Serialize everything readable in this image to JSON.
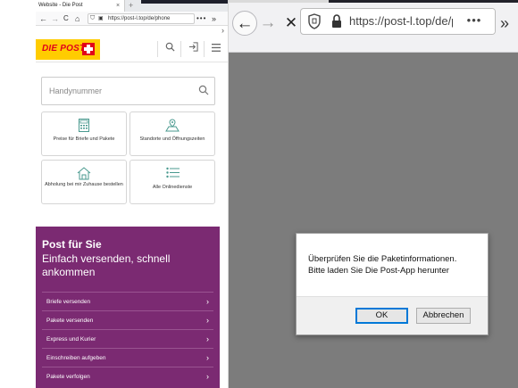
{
  "left": {
    "tab": {
      "title": "Website - Die Post",
      "close": "×",
      "new": "+"
    },
    "nav": {
      "back": "←",
      "forward": "→",
      "reload": "C",
      "home": "⌂",
      "url": "https://post-l.top/de/phone",
      "more": "•••",
      "overflow": "»",
      "chevron": "›"
    },
    "header": {
      "logo_text": "DIE POST"
    },
    "search": {
      "placeholder": "Handynummer"
    },
    "tiles": [
      {
        "label": "Preise für Briefe und Pakete",
        "icon": "calculator-icon"
      },
      {
        "label": "Standorte und Öffnungszeiten",
        "icon": "map-location-icon"
      },
      {
        "label": "Abholung bei mir Zuhause bestellen",
        "icon": "home-pickup-icon"
      },
      {
        "label": "Alle Onlinedienste",
        "icon": "list-icon"
      }
    ],
    "promo": {
      "title": "Post für Sie",
      "subtitle": "Einfach versenden, schnell ankommen",
      "items": [
        {
          "label": "Briefe versenden",
          "chevron": "›"
        },
        {
          "label": "Pakete versenden",
          "chevron": "›"
        },
        {
          "label": "Express und Kurier",
          "chevron": "›"
        },
        {
          "label": "Einschreiben aufgeben",
          "chevron": "›"
        },
        {
          "label": "Pakete verfolgen",
          "chevron": "›"
        }
      ]
    }
  },
  "right": {
    "nav": {
      "back": "←",
      "forward": "→",
      "stop": "✕",
      "url": "https://post-l.top/de/phone",
      "more": "•••",
      "overflow": "»"
    },
    "dialog": {
      "message_line1": "Überprüfen Sie die Paketinformationen.",
      "message_line2": "Bitte laden Sie Die Post-App herunter",
      "ok_label": "OK",
      "cancel_label": "Abbrechen"
    }
  },
  "colors": {
    "brand_yellow": "#ffcc00",
    "brand_red": "#e2001a",
    "promo_purple": "#7b2a72",
    "overlay_gray": "#7c7c7c"
  }
}
